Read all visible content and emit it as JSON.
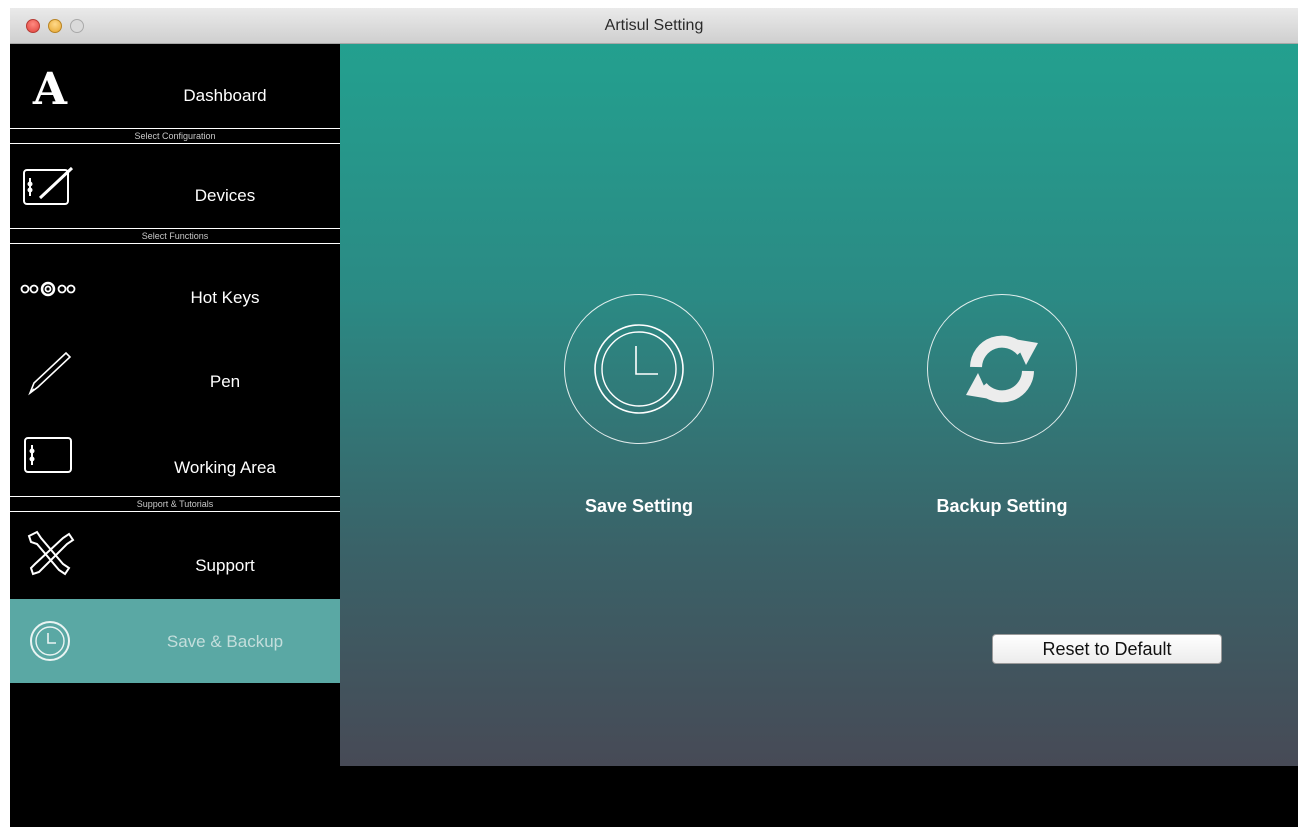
{
  "window": {
    "title": "Artisul Setting"
  },
  "sidebar": {
    "logo_glyph": "A",
    "items": [
      {
        "label": "Dashboard",
        "icon": "logo-icon"
      },
      {
        "label": "Devices",
        "icon": "tablet-pen-icon"
      },
      {
        "label": "Hot Keys",
        "icon": "hotkeys-icon"
      },
      {
        "label": "Pen",
        "icon": "pen-icon"
      },
      {
        "label": "Working Area",
        "icon": "tablet-icon"
      },
      {
        "label": "Support",
        "icon": "tools-icon"
      },
      {
        "label": "Save & Backup",
        "icon": "clock-icon",
        "active": true
      }
    ],
    "sections": [
      "Select Configuration",
      "Select Functions",
      "Support & Tutorials"
    ],
    "hotkeys_glyph": "ooOoo"
  },
  "main": {
    "save_label": "Save Setting",
    "backup_label": "Backup Setting",
    "reset_label": "Reset to Default"
  },
  "colors": {
    "active_item": "#5aa8a4",
    "gradient_top": "#23a08f",
    "gradient_bottom": "#474a56"
  }
}
